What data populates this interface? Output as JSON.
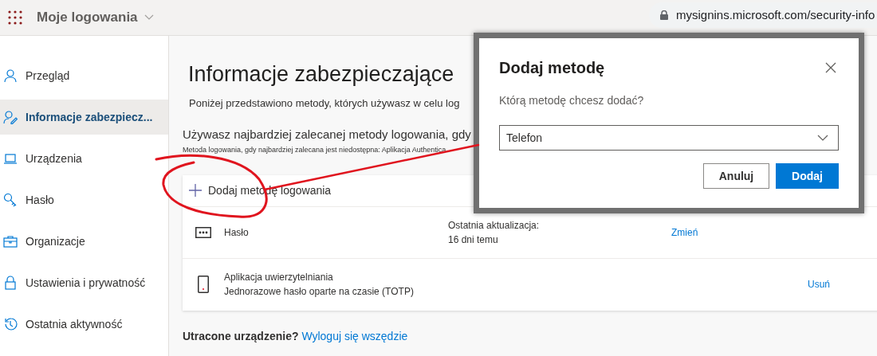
{
  "header": {
    "app_title": "Moje logowania"
  },
  "address_bar": {
    "url": "mysignins.microsoft.com/security-info"
  },
  "sidebar": {
    "items": [
      {
        "label": "Przegląd",
        "selected": false
      },
      {
        "label": "Informacje zabezpiecz...",
        "selected": true
      },
      {
        "label": "Urządzenia",
        "selected": false
      },
      {
        "label": "Hasło",
        "selected": false
      },
      {
        "label": "Organizacje",
        "selected": false
      },
      {
        "label": "Ustawienia i prywatność",
        "selected": false
      },
      {
        "label": "Ostatnia aktywność",
        "selected": false
      }
    ]
  },
  "main": {
    "title": "Informacje zabezpieczające",
    "subtitle": "Poniżej przedstawiono metody, których używasz w celu log",
    "default_method_text": "Używasz najbardziej zalecanej metody logowania, gdy",
    "default_method_note": "Metoda logowania, gdy najbardziej zalecana jest niedostępna: Aplikacja Authentica",
    "add_method_label": "Dodaj metodę logowania",
    "methods": [
      {
        "kind": "password",
        "name": "Hasło",
        "updated_label": "Ostatnia aktualizacja:",
        "updated_value": "16 dni temu",
        "action": "Zmień"
      },
      {
        "kind": "app",
        "name": "Aplikacja uwierzytelniania",
        "detail": "Jednorazowe hasło oparte na czasie (TOTP)",
        "action": "Usuń"
      }
    ],
    "lost_device": {
      "question": "Utracone urządzenie?",
      "link": "Wyloguj się wszędzie"
    }
  },
  "dialog": {
    "title": "Dodaj metodę",
    "question": "Którą metodę chcesz dodać?",
    "select_value": "Telefon",
    "buttons": [
      {
        "label": "Anuluj",
        "kind": "secondary"
      },
      {
        "label": "Dodaj",
        "kind": "primary"
      }
    ]
  }
}
